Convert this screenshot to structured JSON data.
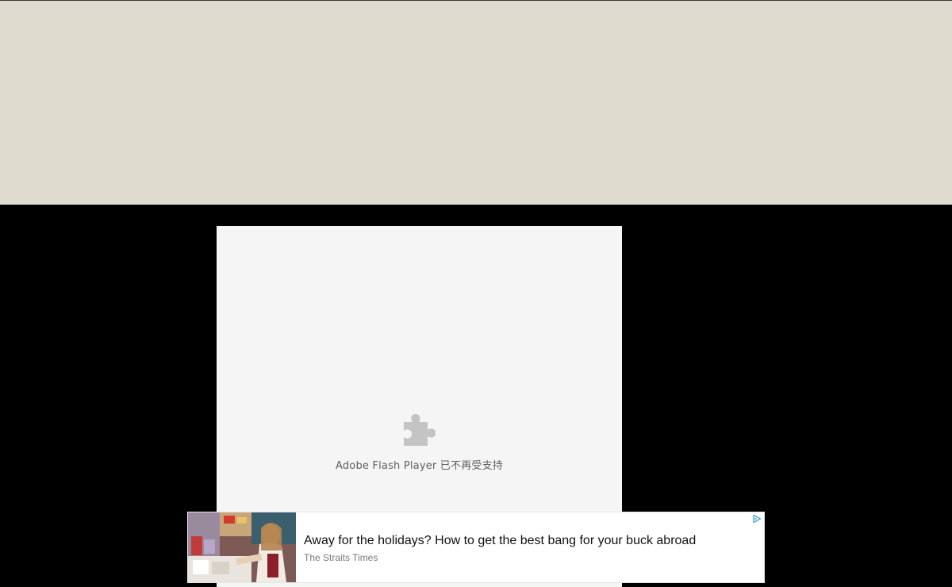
{
  "plugin": {
    "message": "Adobe Flash Player 已不再受支持",
    "icon": "puzzle-piece-icon"
  },
  "ad": {
    "headline": "Away for the holidays? How to get the best bang for your buck abroad",
    "source": "The Straits Times",
    "adchoices_icon": "adchoices-icon"
  },
  "colors": {
    "top_banner": "#dfdbcf",
    "background": "#000000",
    "plugin_box": "#f5f5f5",
    "adchoices": "#4aa6d9"
  }
}
